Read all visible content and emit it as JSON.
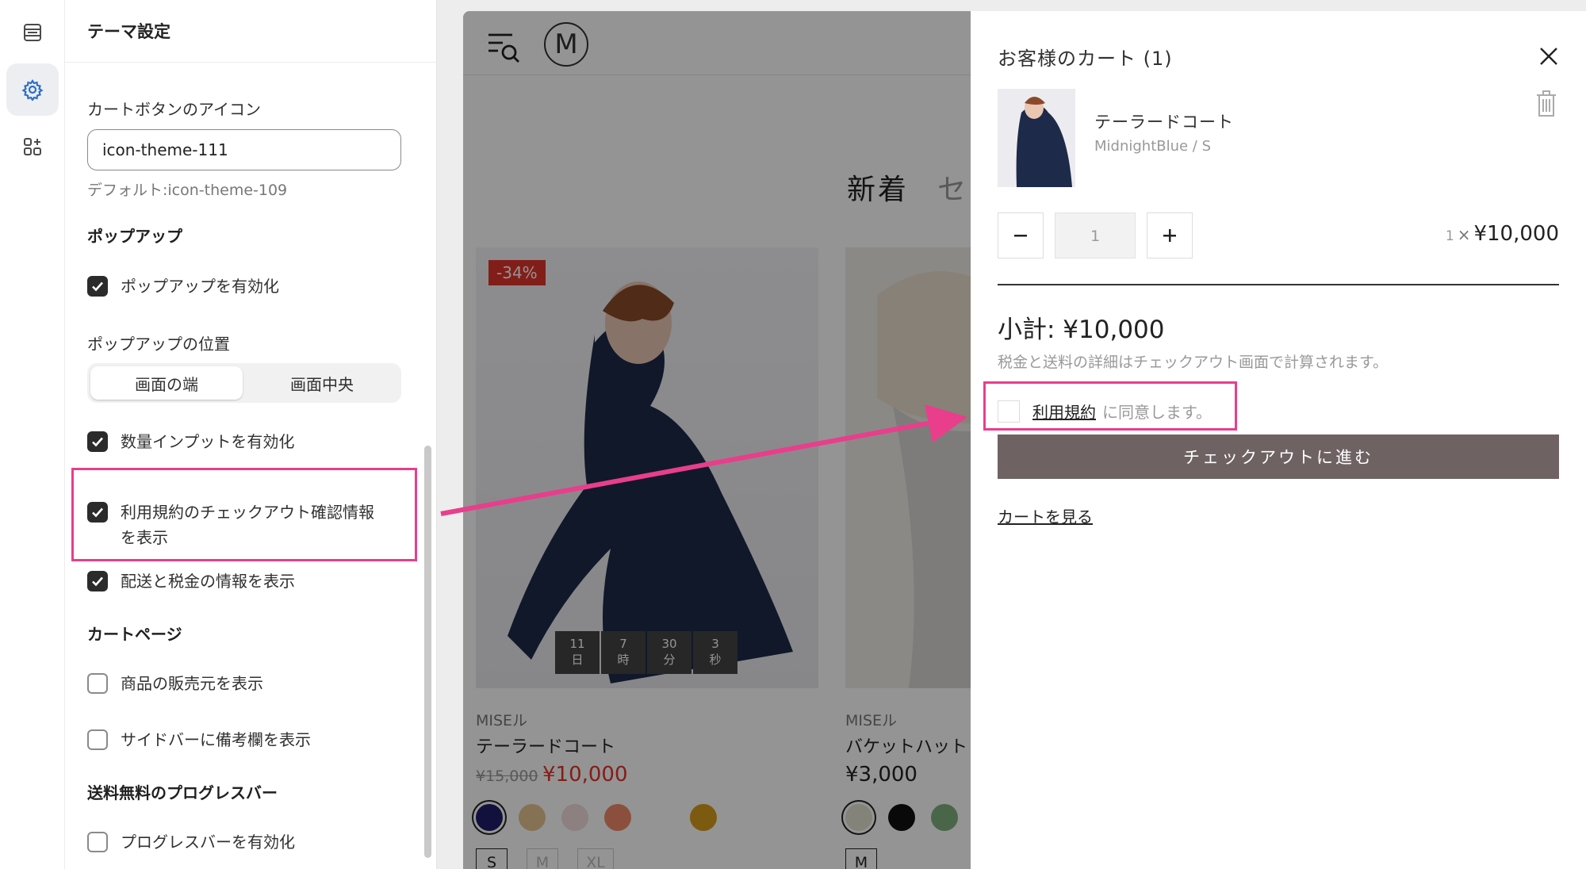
{
  "settings": {
    "title": "テーマ設定",
    "cart_icon_label": "カートボタンのアイコン",
    "cart_icon_value": "icon-theme-111",
    "cart_icon_default": "デフォルト:icon-theme-109",
    "popup_header": "ポップアップ",
    "popup_enable": "ポップアップを有効化",
    "popup_position_label": "ポップアップの位置",
    "popup_position_options": [
      "画面の端",
      "画面中央"
    ],
    "quantity_enable": "数量インプットを有効化",
    "terms_show": "利用規約のチェックアウト確認情報を表示",
    "shipping_tax_show": "配送と税金の情報を表示",
    "cart_page_header": "カートページ",
    "show_vendor": "商品の販売元を表示",
    "sidebar_note": "サイドバーに備考欄を表示",
    "free_shipping_header": "送料無料のプログレスバー",
    "progress_enable": "プログレスバーを有効化"
  },
  "store": {
    "logo_letter": "M",
    "section_tabs": [
      "新着",
      "セ"
    ],
    "products": [
      {
        "badge": "-34%",
        "timer": [
          {
            "v": "11",
            "u": "日"
          },
          {
            "v": "7",
            "u": "時"
          },
          {
            "v": "30",
            "u": "分"
          },
          {
            "v": "3",
            "u": "秒"
          }
        ],
        "vendor": "MISEル",
        "name": "テーラードコート",
        "old_price": "¥15,000",
        "price": "¥10,000",
        "swatches": [
          "#1f1e6b",
          "#e6c493",
          "#f1dcdc",
          "#f08a6a",
          "#ffffff",
          "#d69b1c"
        ],
        "sizes": [
          "S",
          "M",
          "XL"
        ]
      },
      {
        "vendor": "MISEル",
        "name": "バケットハット",
        "price": "¥3,000",
        "swatches": [
          "#e4e2d2",
          "#111111",
          "#7fb07e"
        ],
        "sizes": [
          "M"
        ]
      }
    ]
  },
  "cart": {
    "title": "お客様のカート (1)",
    "item_name": "テーラードコート",
    "item_variant": "MidnightBlue / S",
    "quantity": "1",
    "line_qty": "1",
    "line_times": "×",
    "line_price": "¥10,000",
    "subtotal": "小計: ¥10,000",
    "tax_note": "税金と送料の詳細はチェックアウト画面で計算されます。",
    "terms_link": "利用規約",
    "terms_suffix": "に同意します。",
    "checkout_button": "チェックアウトに進む",
    "view_cart": "カートを見る"
  },
  "colors": {
    "highlight": "#e83e8c",
    "sale": "#e0342b",
    "checkout_bg": "#6e6262"
  }
}
